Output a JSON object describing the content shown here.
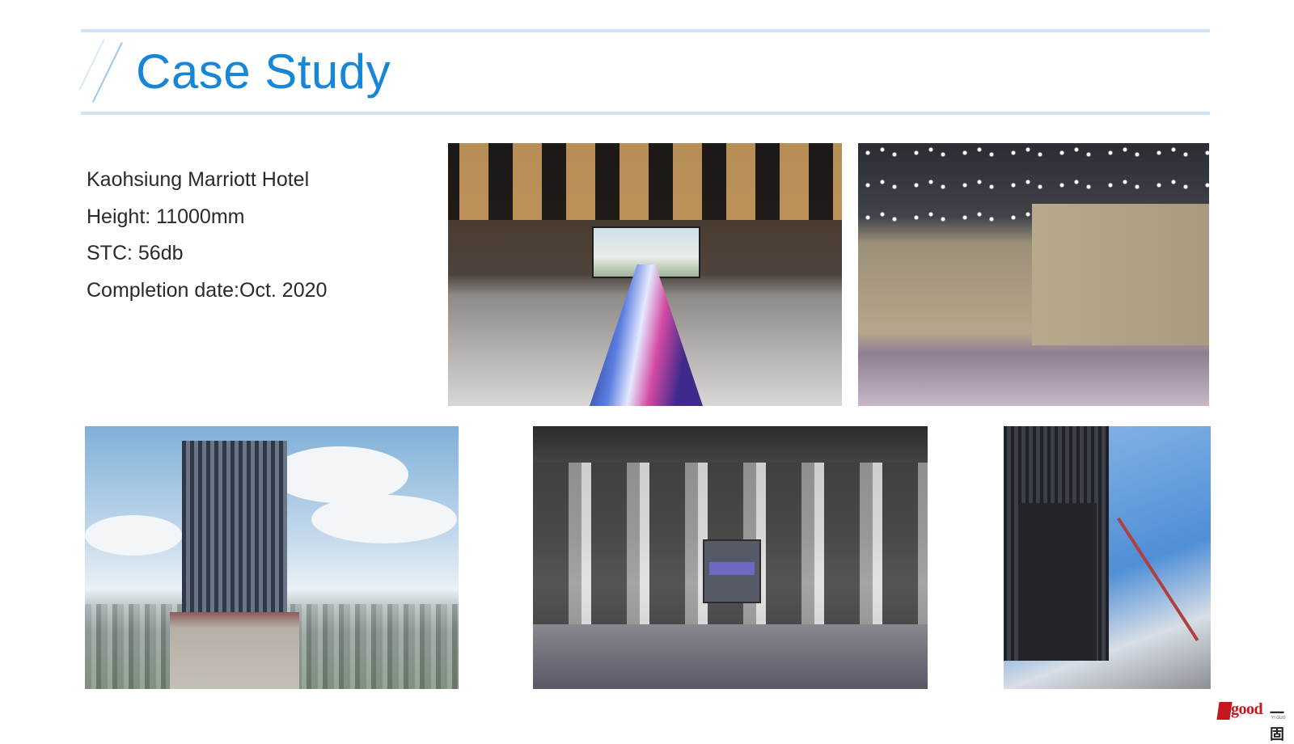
{
  "slide": {
    "title": "Case Study",
    "details": [
      "Kaohsiung Marriott Hotel",
      "Height: 11000mm",
      "STC: 56db",
      "Completion date:Oct. 2020"
    ],
    "accent_color": "#1686d9",
    "rule_color": "#cfe4f7"
  },
  "logo": {
    "word": "good",
    "cn": "一固",
    "sub": "YI GUO",
    "brand_color": "#c4161c"
  }
}
